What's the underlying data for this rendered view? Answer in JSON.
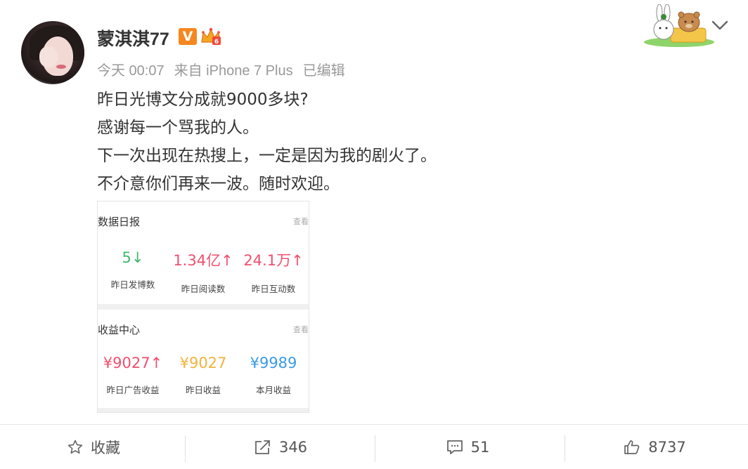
{
  "author": {
    "name": "蒙淇淇77",
    "verified_badge": "V",
    "avatar_icon": "avatar-woman"
  },
  "post": {
    "time": "今天 00:07",
    "source": "来自 iPhone 7 Plus",
    "edited": "已编辑",
    "lines": [
      "昨日光博文分成就9000多块?",
      "感谢每一个骂我的人。",
      "下一次出现在热搜上，一定是因为我的剧火了。",
      "不介意你们再来一波。随时欢迎。"
    ]
  },
  "image_card": {
    "data_report": {
      "title": "数据日报",
      "link": "查看",
      "stats": [
        {
          "value": "5↓",
          "label": "昨日发博数",
          "color": "#3cb96b"
        },
        {
          "value": "1.34亿↑",
          "label": "昨日阅读数",
          "color": "#f0506e"
        },
        {
          "value": "24.1万↑",
          "label": "昨日互动数",
          "color": "#f0506e"
        }
      ]
    },
    "income_center": {
      "title": "收益中心",
      "link": "查看",
      "stats": [
        {
          "value": "¥9027↑",
          "label": "昨日广告收益",
          "color": "#f0506e"
        },
        {
          "value": "¥9027",
          "label": "昨日收益",
          "color": "#f4b23e"
        },
        {
          "value": "¥9989",
          "label": "本月收益",
          "color": "#3a9ae8"
        }
      ]
    }
  },
  "actions": {
    "favorite": {
      "label": "收藏",
      "icon": "star-icon"
    },
    "repost": {
      "label": "346",
      "icon": "share-icon"
    },
    "comment": {
      "label": "51",
      "icon": "comment-icon"
    },
    "like": {
      "label": "8737",
      "icon": "thumbs-up-icon"
    }
  },
  "colors": {
    "badge_orange": "#f5871f",
    "meta_gray": "#999999"
  }
}
